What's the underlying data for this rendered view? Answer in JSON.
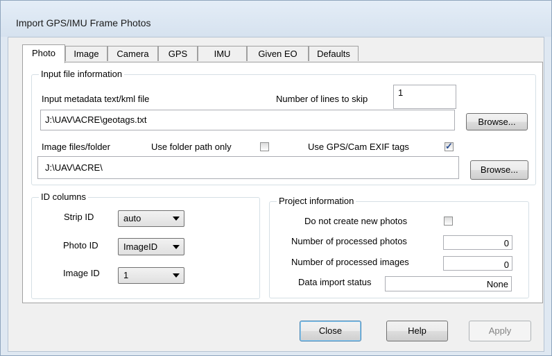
{
  "window": {
    "title": "Import GPS/IMU Frame Photos"
  },
  "tabs": [
    {
      "label": "Photo"
    },
    {
      "label": "Image"
    },
    {
      "label": "Camera"
    },
    {
      "label": "GPS"
    },
    {
      "label": "IMU"
    },
    {
      "label": "Given EO"
    },
    {
      "label": "Defaults"
    }
  ],
  "input_file": {
    "legend": "Input file information",
    "metadata_label": "Input metadata text/kml file",
    "skip_label": "Number of lines to skip",
    "skip_value": "1",
    "metadata_path": "J:\\UAV\\ACRE\\geotags.txt",
    "browse1": "Browse...",
    "image_label": "Image files/folder",
    "folder_only_label": "Use folder path only",
    "folder_only_checked": false,
    "exif_label": "Use GPS/Cam EXIF tags",
    "exif_checked": true,
    "image_path": "J:\\UAV\\ACRE\\",
    "browse2": "Browse..."
  },
  "id_columns": {
    "legend": "ID columns",
    "strip_label": "Strip ID",
    "strip_value": "auto",
    "photo_label": "Photo ID",
    "photo_value": "ImageID",
    "image_label": "Image ID",
    "image_value": "1"
  },
  "project": {
    "legend": "Project information",
    "no_new_label": "Do not create new photos",
    "no_new_checked": false,
    "photos_label": "Number of processed photos",
    "photos_value": "0",
    "images_label": "Number of processed images",
    "images_value": "0",
    "status_label": "Data import status",
    "status_value": "None"
  },
  "buttons": {
    "close": "Close",
    "help": "Help",
    "apply": "Apply"
  }
}
